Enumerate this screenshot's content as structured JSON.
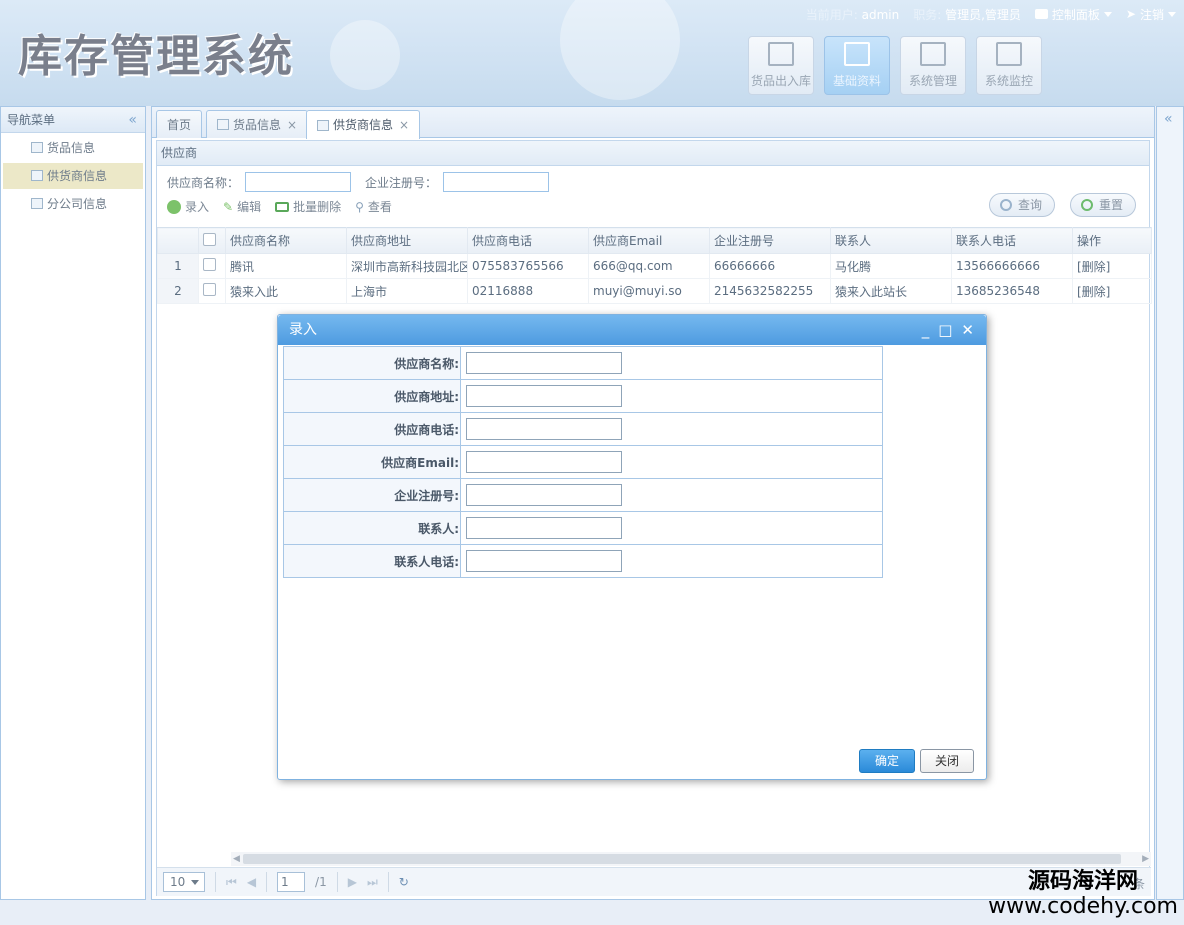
{
  "app": {
    "title": "库存管理系统"
  },
  "userbar": {
    "current_user_label": "当前用户:",
    "current_user": "admin",
    "role_label": "职务:",
    "roles": "管理员,管理员",
    "control_panel": "控制面板",
    "logout": "注销"
  },
  "modules": [
    {
      "label": "货品出入库",
      "icon": "edit-icon",
      "active": false
    },
    {
      "label": "基础资料",
      "icon": "edit-icon",
      "active": true
    },
    {
      "label": "系统管理",
      "icon": "sliders-icon",
      "active": false
    },
    {
      "label": "系统监控",
      "icon": "monitor-icon",
      "active": false
    }
  ],
  "sidebar": {
    "title": "导航菜单",
    "items": [
      {
        "label": "货品信息",
        "active": false
      },
      {
        "label": "供货商信息",
        "active": true
      },
      {
        "label": "分公司信息",
        "active": false
      }
    ]
  },
  "tabs": [
    {
      "label": "首页",
      "closable": false
    },
    {
      "label": "货品信息",
      "closable": true
    },
    {
      "label": "供货商信息",
      "closable": true,
      "active": true
    }
  ],
  "panel": {
    "title": "供应商",
    "search": {
      "name_label": "供应商名称：",
      "reg_label": "企业注册号："
    },
    "toolbar": {
      "add": "录入",
      "edit": "编辑",
      "batch_delete": "批量删除",
      "view": "查看"
    },
    "query_button": "查询",
    "reset_button": "重置"
  },
  "grid": {
    "columns": [
      "供应商名称",
      "供应商地址",
      "供应商电话",
      "供应商Email",
      "企业注册号",
      "联系人",
      "联系人电话",
      "操作"
    ],
    "rows": [
      {
        "num": "1",
        "name": "腾讯",
        "address": "深圳市高新科技园北区",
        "phone": "075583765566",
        "email": "666@qq.com",
        "reg": "66666666",
        "contact": "马化腾",
        "contact_phone": "13566666666",
        "action": "[删除]"
      },
      {
        "num": "2",
        "name": "猿来入此",
        "address": "上海市",
        "phone": "02116888",
        "email": "muyi@muyi.so",
        "reg": "2145632582255",
        "contact": "猿来入此站长",
        "contact_phone": "13685236548",
        "action": "[删除]"
      }
    ]
  },
  "pager": {
    "page_size": "10",
    "page": "1",
    "total_pages": "/1",
    "info": "条"
  },
  "dialog": {
    "title": "录入",
    "fields": [
      {
        "label": "供应商名称:"
      },
      {
        "label": "供应商地址:"
      },
      {
        "label": "供应商电话:"
      },
      {
        "label": "供应商Email:"
      },
      {
        "label": "企业注册号:"
      },
      {
        "label": "联系人:"
      },
      {
        "label": "联系人电话:"
      }
    ],
    "ok": "确定",
    "close": "关闭"
  },
  "watermark": {
    "line1": "源码海洋网",
    "line2": "www.codehy.com"
  },
  "colors": {
    "accent": "#4e9be0",
    "nav_active": "#ece8c8",
    "border": "#a8c7e6"
  }
}
